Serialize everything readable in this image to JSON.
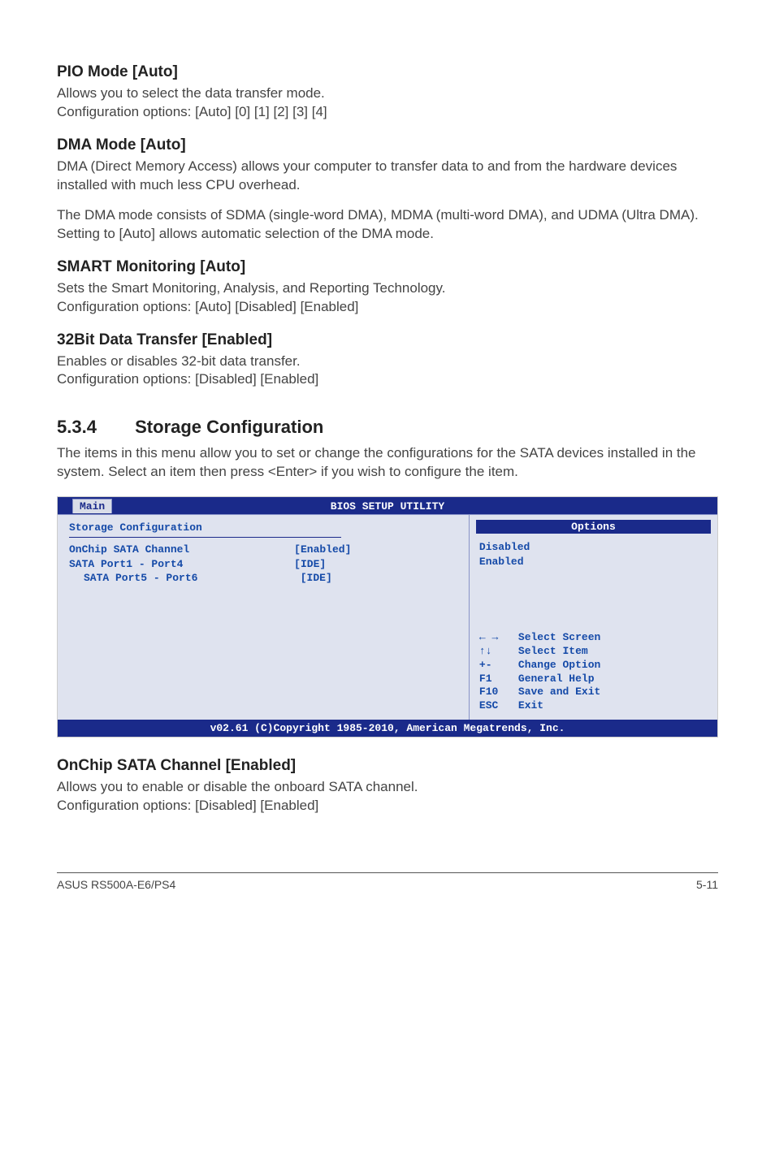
{
  "sections": {
    "pio": {
      "heading": "PIO Mode [Auto]",
      "p1": "Allows you to select the data transfer mode.",
      "p2": "Configuration options: [Auto] [0] [1] [2] [3] [4]"
    },
    "dma": {
      "heading": "DMA Mode [Auto]",
      "p1": "DMA (Direct Memory Access) allows your computer to transfer data to and from the hardware devices installed with much less CPU overhead.",
      "p2": "The DMA mode consists of SDMA (single-word DMA), MDMA (multi-word DMA), and UDMA (Ultra DMA). Setting to [Auto] allows automatic selection of the DMA mode."
    },
    "smart": {
      "heading": "SMART Monitoring [Auto]",
      "p1": "Sets the Smart Monitoring, Analysis, and Reporting Technology.",
      "p2": "Configuration options: [Auto] [Disabled] [Enabled]"
    },
    "bit32": {
      "heading": "32Bit Data Transfer [Enabled]",
      "p1": "Enables or disables 32-bit data transfer.",
      "p2": "Configuration options: [Disabled] [Enabled]"
    },
    "storage": {
      "num": "5.3.4",
      "title": "Storage Configuration",
      "intro": "The items in this menu allow you to set or change the configurations for the SATA devices installed in the system. Select an item then press <Enter> if you wish to configure the item."
    },
    "onchip": {
      "heading": "OnChip SATA Channel [Enabled]",
      "p1": "Allows you to enable or disable the onboard SATA channel.",
      "p2": "Configuration options: [Disabled] [Enabled]"
    }
  },
  "bios": {
    "title": "BIOS SETUP UTILITY",
    "tab": "Main",
    "left_title": "Storage Configuration",
    "rows": [
      {
        "label": "OnChip SATA Channel",
        "value": "[Enabled]",
        "indent": false
      },
      {
        "label": "SATA Port1 - Port4",
        "value": "[IDE]",
        "indent": false
      },
      {
        "label": "SATA Port5 - Port6",
        "value": "[IDE]",
        "indent": true
      }
    ],
    "options_header": "Options",
    "options": [
      "Disabled",
      "Enabled"
    ],
    "help": [
      {
        "key": "← →",
        "text": "Select Screen"
      },
      {
        "key": "↑↓",
        "text": "Select Item"
      },
      {
        "key": "+-",
        "text": "Change Option"
      },
      {
        "key": "F1",
        "text": "General Help"
      },
      {
        "key": "F10",
        "text": "Save and Exit"
      },
      {
        "key": "ESC",
        "text": "Exit"
      }
    ],
    "footer": "v02.61 (C)Copyright 1985-2010, American Megatrends, Inc."
  },
  "footer": {
    "left": "ASUS RS500A-E6/PS4",
    "right": "5-11"
  }
}
